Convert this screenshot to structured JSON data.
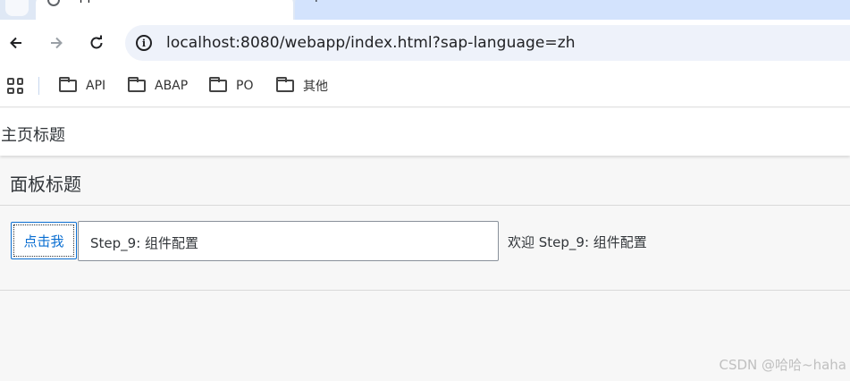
{
  "browser": {
    "tabs": [
      {
        "title": "apptitle",
        "close_glyph": "✕"
      },
      {
        "title": "+"
      }
    ],
    "url": "localhost:8080/webapp/index.html?sap-language=zh",
    "icons": {
      "back": "back-arrow-icon",
      "forward": "forward-arrow-icon",
      "reload": "reload-icon",
      "info": "info-icon",
      "info_glyph": "i"
    },
    "bookmarks": [
      "API",
      "ABAP",
      "PO",
      "其他"
    ]
  },
  "app": {
    "header_title": "主页标题",
    "panel_title": "面板标题",
    "button_label": "点击我",
    "input_value": "Step_9: 组件配置",
    "greeting": "欢迎 Step_9: 组件配置"
  },
  "watermark": "CSDN @哈哈~haha",
  "colors": {
    "tab_strip": "#dfe8f5",
    "accent": "#0a6ed1",
    "page_bg": "#f7f7f7"
  }
}
